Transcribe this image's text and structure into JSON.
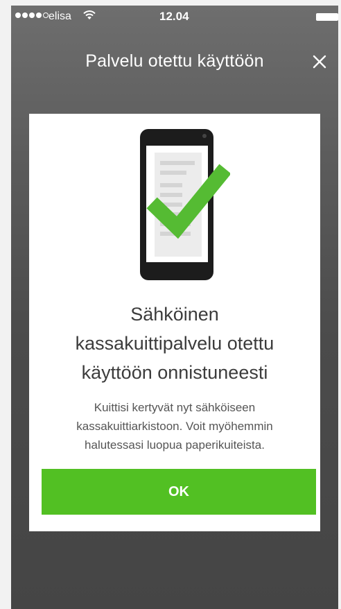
{
  "status_bar": {
    "carrier": "elisa",
    "time": "12.04",
    "signal_bars_filled": 4,
    "signal_bars_total": 5
  },
  "header": {
    "title": "Palvelu otettu käyttöön",
    "close_icon": "close-icon"
  },
  "card": {
    "illustration_icon": "phone-receipt-checkmark-icon",
    "title_lines": [
      "Sähköinen",
      "kassakuittipalvelu otettu",
      "käyttöön onnistuneesti"
    ],
    "description_lines": [
      "Kuittisi kertyvät nyt sähköiseen",
      "kassakuittiarkistoon. Voit myöhemmin",
      "halutessasi luopua paperikuiteista."
    ],
    "ok_label": "OK"
  },
  "colors": {
    "accent_green": "#52c023",
    "check_green": "#55bb33",
    "overlay_dark": "#4b4b4b",
    "card_background": "#ffffff",
    "title_text": "#3c3c3c"
  }
}
